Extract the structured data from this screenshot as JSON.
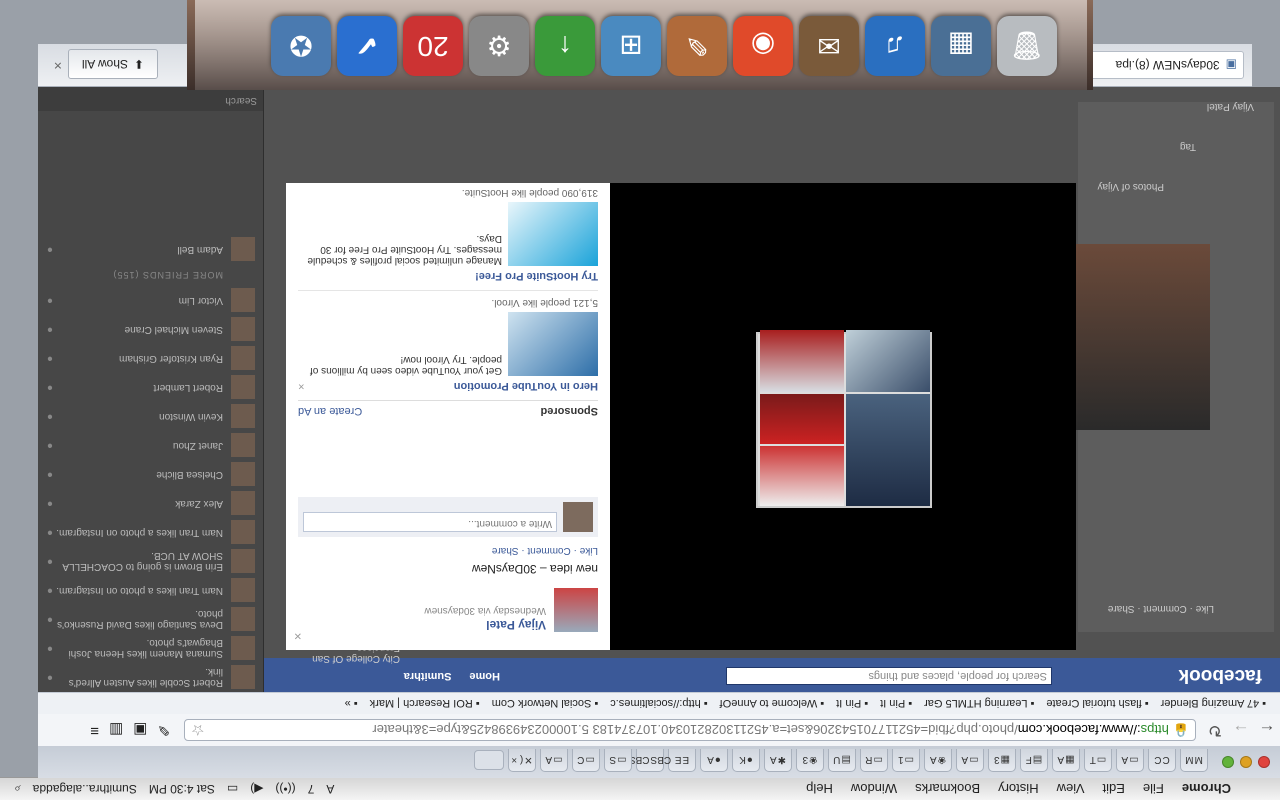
{
  "menubar": {
    "apple_glyph": "",
    "items": [
      "Chrome",
      "File",
      "Edit",
      "View",
      "History",
      "Bookmarks",
      "Window",
      "Help"
    ],
    "status": {
      "battery_glyph": "▭",
      "clock": "Sat 4:30 PM",
      "user": "Sumithra..alagadda",
      "spotlight": "⌕",
      "lang": "A",
      "num": "7"
    }
  },
  "tabs": [
    {
      "icon": "M",
      "label": "M"
    },
    {
      "icon": "C",
      "label": "C"
    },
    {
      "icon": "▭",
      "label": "A"
    },
    {
      "icon": "▭",
      "label": "T"
    },
    {
      "icon": "▦",
      "label": "A"
    },
    {
      "icon": "▤",
      "label": "F"
    },
    {
      "icon": "▦",
      "label": "3"
    },
    {
      "icon": "▭",
      "label": "A"
    },
    {
      "icon": "❀",
      "label": "A"
    },
    {
      "icon": "▭",
      "label": "1"
    },
    {
      "icon": "▭",
      "label": "R"
    },
    {
      "icon": "▤",
      "label": "U"
    },
    {
      "icon": "❀",
      "label": "3"
    },
    {
      "icon": "✱",
      "label": "A"
    },
    {
      "icon": "●",
      "label": "K"
    },
    {
      "icon": "●",
      "label": "A"
    },
    {
      "icon": "E",
      "label": "E"
    },
    {
      "icon": "CBS",
      "label": "CBS"
    },
    {
      "icon": "▭",
      "label": "S"
    },
    {
      "icon": "▭",
      "label": "C"
    },
    {
      "icon": "▭",
      "label": "A"
    },
    {
      "icon": "✕",
      "label": "( ×"
    }
  ],
  "address": {
    "scheme": "https",
    "host": "://www.facebook.com",
    "path": "/photo.php?fbid=452117701543206&set=a.452113028210340.107374183 5.100002349398425&type=3&theater"
  },
  "bookmarks": [
    "47 Amazing Blender",
    "flash tutorial Create",
    "Learning HTML5 Gar",
    "Pin It",
    "Pin It",
    "Welcome to AnneOf",
    "http://socialtimes.c",
    "Social Network Com",
    "ROI Research | Mark",
    "»"
  ],
  "facebook": {
    "logo": "facebook",
    "search_placeholder": "Search for people, places and things",
    "nav": [
      "Sumithra",
      "Home"
    ],
    "post": {
      "name": "Vijay Patel",
      "meta": "Wednesday via 30daysnew",
      "caption": "new idea – 30DaysNew",
      "actions": "Like · Comment · Share",
      "comment_placeholder": "Write a comment...",
      "close": "×"
    },
    "sponsored": {
      "title": "Sponsored",
      "create": "Create an Ad"
    },
    "ads": [
      {
        "title": "Hero in YouTube Promotion",
        "body": "Get your YouTube video seen by millions of people. Try Virool now!",
        "likes": "5,121 people like Virool.",
        "close": "×"
      },
      {
        "title": "Try HootSuite Pro Free!",
        "body": "Manage unlimited social profiles & schedule messages. Try HootSuite Pro Free for 30 Days.",
        "likes": "319,090 people like HootSuite."
      }
    ],
    "chat": [
      "Robert Scoble likes Austen Allred's link.",
      "Sumana Manem likes Heena Joshi Bhagwat's photo.",
      "Deva Santiago likes David Rusenko's photo.",
      "Nam Tran likes a photo on Instagram.",
      "Erin Brown is going to COACHELLA SHOW AT UCB.",
      "Nam Tran likes a photo on Instagram.",
      "Alex Zarak",
      "Chelsea Bliche",
      "Janet Zhou",
      "Kevin Winston",
      "Robert Lambert",
      "Ryan Kristofer Grisham",
      "Steven Michael Crane",
      "Victor Lim"
    ],
    "chat_divider": "MORE FRIENDS (155)",
    "chat_after": [
      "Adam Bell"
    ],
    "chat_search": "Search",
    "bg": {
      "tag": "Tag",
      "photos_of": "Photos of Vijay",
      "like_comment": "Like · Comment · Share",
      "school": "City College Of San Francisco",
      "name_tag": "Vijay Patel"
    }
  },
  "shelf": {
    "file": "30daysNEW (8).ipa",
    "show_all": "Show All",
    "close": "×"
  },
  "dock_icons": [
    "🗑",
    "▦",
    "♫",
    "✉",
    "◉",
    "✎",
    "⊞",
    "↑",
    "⚙",
    "20",
    "✔",
    "✪"
  ]
}
